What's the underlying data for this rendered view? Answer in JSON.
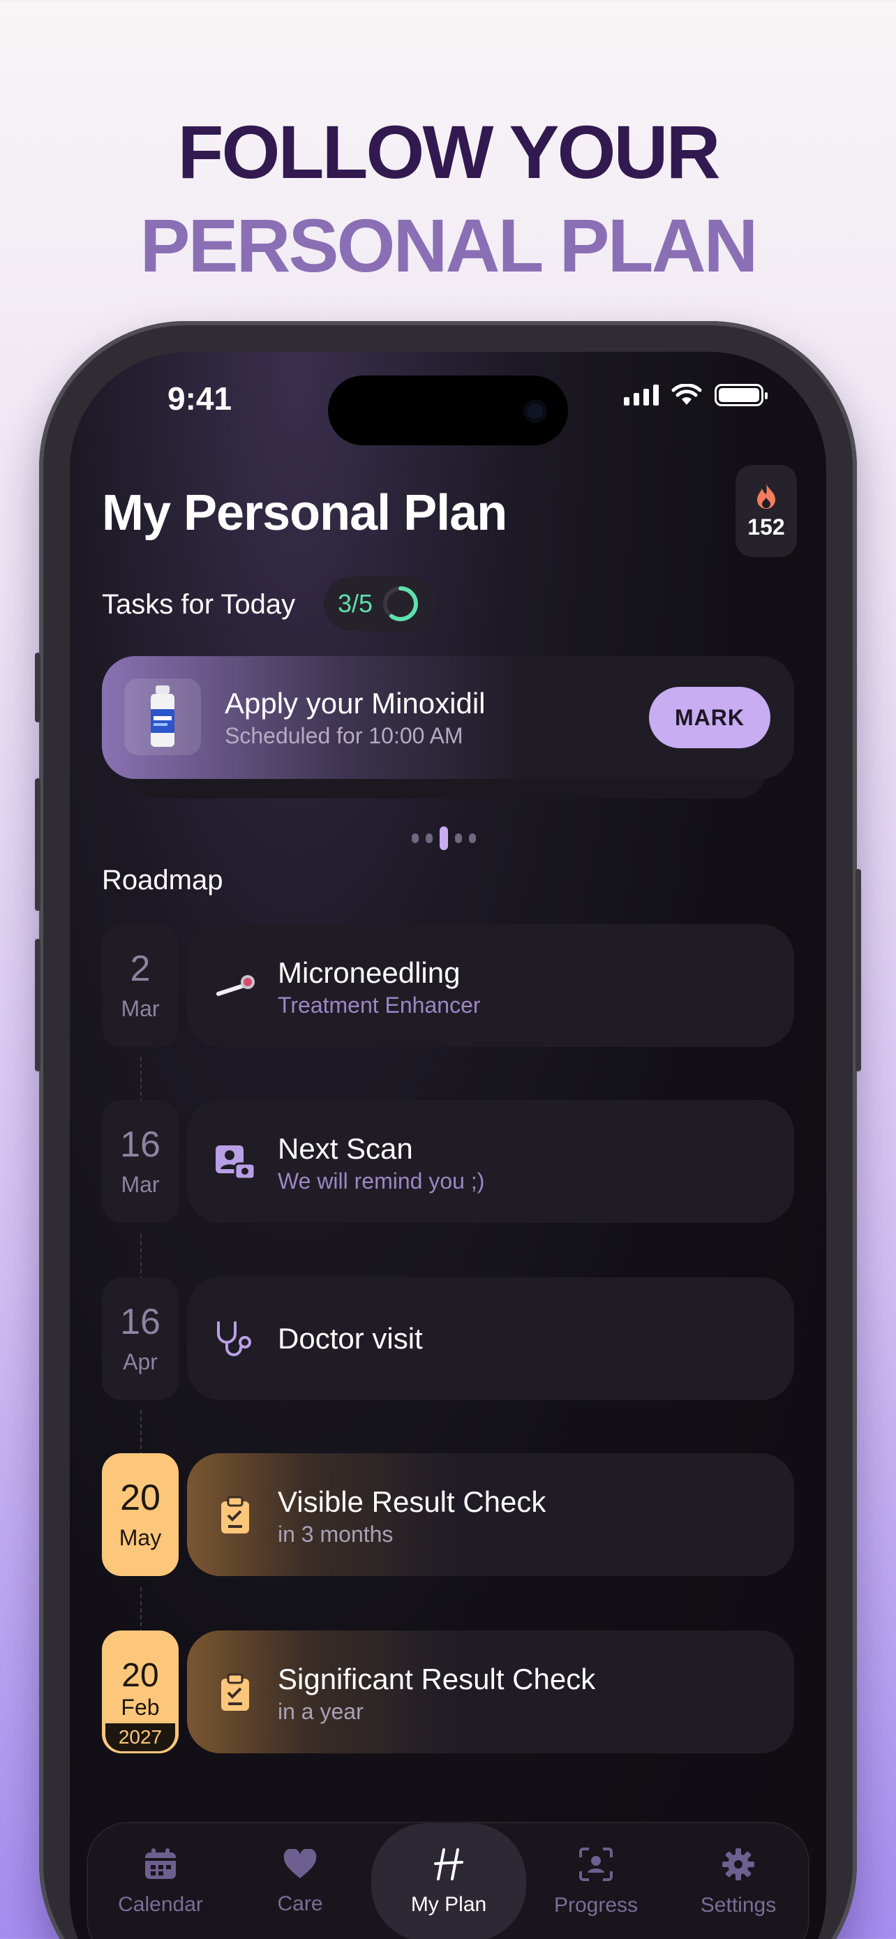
{
  "headline": {
    "line1": "FOLLOW YOUR",
    "line2": "PERSONAL PLAN"
  },
  "status_bar": {
    "time": "9:41"
  },
  "header": {
    "title": "My Personal Plan",
    "streak_count": "152",
    "streak_icon": "flame-icon"
  },
  "tasks": {
    "label": "Tasks for Today",
    "progress_text": "3/5",
    "progress_fraction": 0.6,
    "current": {
      "title": "Apply your Minoxidil",
      "subtitle": "Scheduled for 10:00 AM",
      "action": "MARK"
    },
    "pager_count": 5,
    "pager_active": 2
  },
  "roadmap": {
    "label": "Roadmap",
    "items": [
      {
        "day": "2",
        "month": "Mar",
        "title": "Microneedling",
        "subtitle": "Treatment Enhancer",
        "icon": "microneedle-roller-icon"
      },
      {
        "day": "16",
        "month": "Mar",
        "title": "Next Scan",
        "subtitle": "We will remind you ;)",
        "icon": "photo-scan-icon"
      },
      {
        "day": "16",
        "month": "Apr",
        "title": "Doctor visit",
        "subtitle": "",
        "icon": "stethoscope-icon"
      },
      {
        "day": "20",
        "month": "May",
        "title": "Visible Result Check",
        "subtitle": "in 3 months",
        "icon": "clipboard-check-icon"
      },
      {
        "day": "20",
        "month": "Feb",
        "year": "2027",
        "title": "Significant Result Check",
        "subtitle": "in a year",
        "icon": "clipboard-check-icon"
      }
    ]
  },
  "tabbar": {
    "tabs": [
      {
        "label": "Calendar",
        "icon": "calendar-icon"
      },
      {
        "label": "Care",
        "icon": "heart-icon"
      },
      {
        "label": "My Plan",
        "icon": "plan-logo-icon",
        "active": true
      },
      {
        "label": "Progress",
        "icon": "face-scan-icon"
      },
      {
        "label": "Settings",
        "icon": "gear-icon"
      }
    ]
  },
  "colors": {
    "accent": "#c8adf2",
    "highlight": "#fcc77a",
    "success": "#5fe0ac",
    "background": "#121016"
  }
}
